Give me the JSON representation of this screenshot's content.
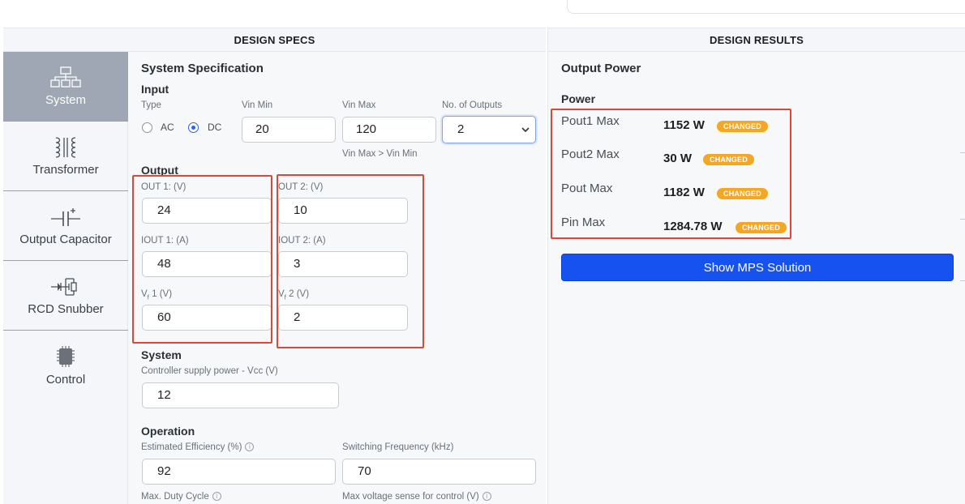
{
  "headers": {
    "specs": "DESIGN SPECS",
    "results": "DESIGN RESULTS"
  },
  "sidebar": {
    "items": [
      {
        "label": "System",
        "icon": "system-block-icon",
        "active": true
      },
      {
        "label": "Transformer",
        "icon": "transformer-icon",
        "active": false
      },
      {
        "label": "Output Capacitor",
        "icon": "capacitor-icon",
        "active": false
      },
      {
        "label": "RCD Snubber",
        "icon": "snubber-icon",
        "active": false
      },
      {
        "label": "Control",
        "icon": "chip-icon",
        "active": false
      }
    ]
  },
  "specs": {
    "title": "System Specification",
    "input": {
      "heading": "Input",
      "type_label": "Type",
      "type_options": [
        "AC",
        "DC"
      ],
      "type_selected": "DC",
      "vin_min_label": "Vin Min",
      "vin_min": "20",
      "vin_max_label": "Vin Max",
      "vin_max": "120",
      "vin_hint": "Vin Max > Vin Min",
      "outputs_label": "No. of Outputs",
      "outputs": "2"
    },
    "output": {
      "heading": "Output",
      "out1_label": "OUT 1: (V)",
      "out1": "24",
      "iout1_label": "IOUT 1: (A)",
      "iout1": "48",
      "vf1_label_main": "V",
      "vf1_label_sub": "f",
      "vf1_label_rest": " 1 (V)",
      "vf1": "60",
      "out2_label": "OUT 2: (V)",
      "out2": "10",
      "iout2_label": "IOUT 2: (A)",
      "iout2": "3",
      "vf2_label_main": "V",
      "vf2_label_sub": "f",
      "vf2_label_rest": " 2 (V)",
      "vf2": "2"
    },
    "system": {
      "heading": "System",
      "vcc_label": "Controller supply power - Vcc (V)",
      "vcc": "12"
    },
    "operation": {
      "heading": "Operation",
      "eff_label": "Estimated Efficiency (%)",
      "eff": "92",
      "fsw_label": "Switching Frequency (kHz)",
      "fsw": "70",
      "duty_label": "Max. Duty Cycle",
      "vsense_label": "Max voltage sense for control (V)"
    }
  },
  "results": {
    "title": "Output Power",
    "power_heading": "Power",
    "rows": [
      {
        "label": "Pout1 Max",
        "value": "1152 W",
        "badge": "CHANGED"
      },
      {
        "label": "Pout2 Max",
        "value": "30 W",
        "badge": "CHANGED"
      },
      {
        "label": "Pout Max",
        "value": "1182 W",
        "badge": "CHANGED"
      },
      {
        "label": "Pin Max",
        "value": "1284.78 W",
        "badge": "CHANGED"
      }
    ],
    "button": "Show MPS Solution"
  },
  "colors": {
    "accent": "#1652f0",
    "badge": "#f5a623",
    "highlight": "#d9483b",
    "sidebar_active": "#9ea7b3"
  }
}
